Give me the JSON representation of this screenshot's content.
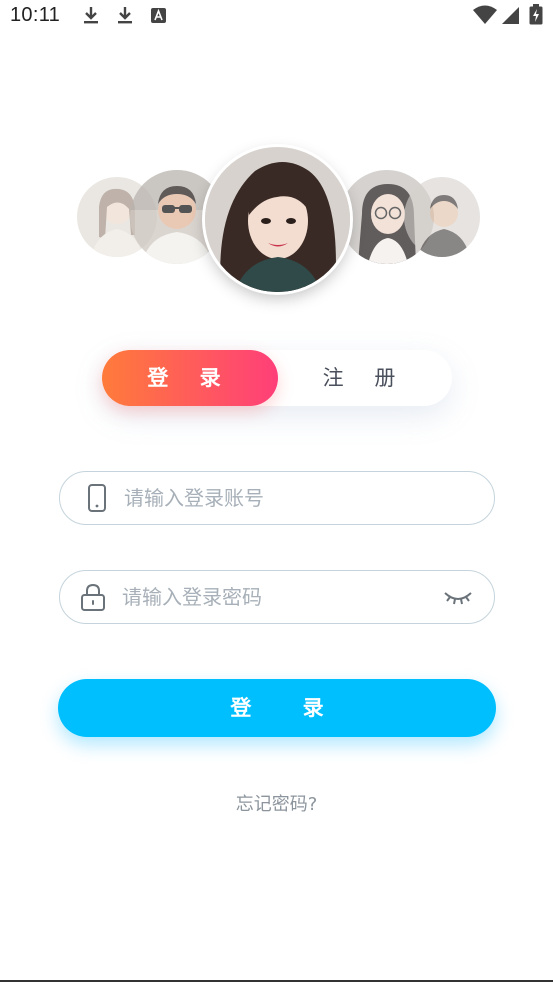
{
  "status_bar": {
    "time": "10:11",
    "left_icons": [
      "download-icon",
      "download-icon",
      "text-a-icon"
    ],
    "right_icons": [
      "wifi-icon",
      "signal-icon",
      "battery-charging-icon"
    ]
  },
  "avatars": [
    {
      "name": "avatar-woman-left"
    },
    {
      "name": "avatar-man-sunglasses"
    },
    {
      "name": "avatar-woman-center"
    },
    {
      "name": "avatar-woman-glasses"
    },
    {
      "name": "avatar-man-right"
    }
  ],
  "tabs": {
    "login_label": "登 录",
    "register_label": "注 册",
    "active": "login",
    "active_gradient": [
      "#ff7b3a",
      "#ff3f79"
    ]
  },
  "account_field": {
    "placeholder": "请输入登录账号",
    "value": "",
    "icon": "phone-icon"
  },
  "password_field": {
    "placeholder": "请输入登录密码",
    "value": "",
    "icon": "lock-icon",
    "toggle_icon": "eye-closed-icon"
  },
  "login_button": {
    "label": "登 录",
    "color": "#00bfff"
  },
  "forgot_password": {
    "label": "忘记密码?"
  }
}
